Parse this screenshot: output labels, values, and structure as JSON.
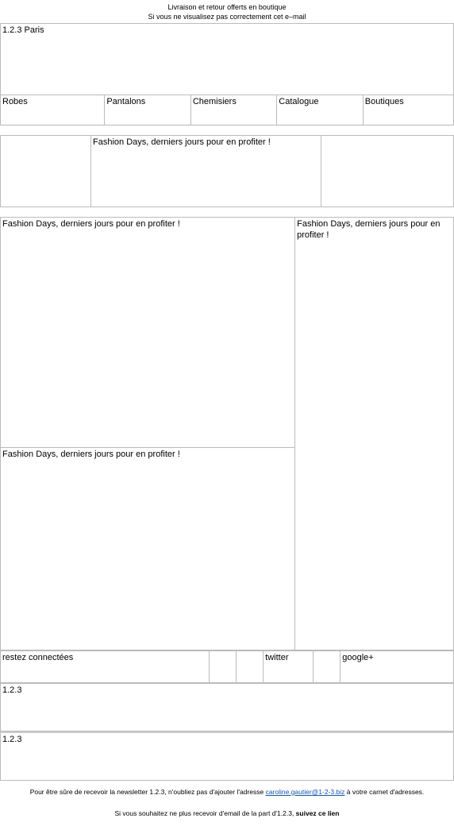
{
  "preheader": {
    "line1": "Livraison et retour offerts en boutique",
    "line2": "Si vous ne visualisez pas correctement cet e–mail"
  },
  "logo": "1.2.3 Paris",
  "nav": {
    "robes": "Robes",
    "pantalons": "Pantalons",
    "chemisiers": "Chemisiers",
    "catalogue": "Catalogue",
    "boutiques": "Boutiques"
  },
  "hero": {
    "title": "Fashion Days, derniers jours pour en profiter !"
  },
  "grid": {
    "topleft": "Fashion Days, derniers jours pour en profiter !",
    "right": "Fashion Days, derniers jours pour en profiter !",
    "bottomleft": "Fashion Days, derniers jours pour en profiter !"
  },
  "social": {
    "label": "restez connectées",
    "twitter": "twitter",
    "google": "google+"
  },
  "footer": {
    "brand": "1.2.3"
  },
  "footnote": {
    "prefix": "Pour être sûre de recevoir la newsletter 1.2.3, n'oubliez pas d'ajouter l'adresse ",
    "email": "caroline.gautier@1-2-3.biz",
    "suffix": " à votre carnet d'adresses.",
    "unsub_prefix": "Si vous souhaitez ne plus recevoir d'email de la part d'1.2.3, ",
    "unsub_link": "suivez ce lien"
  }
}
